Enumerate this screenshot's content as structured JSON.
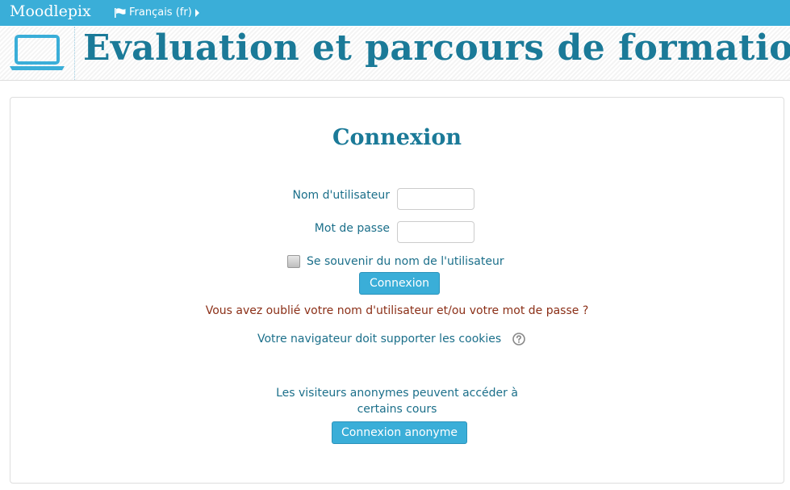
{
  "navbar": {
    "brand": "Moodlepix",
    "language": "Français (fr)",
    "language_icon": "flag-icon",
    "language_caret_icon": "caret-right-icon",
    "color": "#3aaed8"
  },
  "header": {
    "icon": "laptop-icon",
    "title": "Evaluation et parcours de formation"
  },
  "login": {
    "title": "Connexion",
    "username_label": "Nom d'utilisateur",
    "username_value": "",
    "password_label": "Mot de passe",
    "password_value": "",
    "remember_label": "Se souvenir du nom de l'utilisateur",
    "remember_checked": false,
    "submit_label": "Connexion",
    "forgot_text": "Vous avez oublié votre nom d'utilisateur et/ou votre mot de passe ?",
    "cookies_text": "Votre navigateur doit supporter les cookies",
    "cookies_help_icon": "question-circle-icon"
  },
  "guest": {
    "line1": "Les visiteurs anonymes peuvent accéder à",
    "line2": "certains cours",
    "button_label": "Connexion anonyme"
  }
}
